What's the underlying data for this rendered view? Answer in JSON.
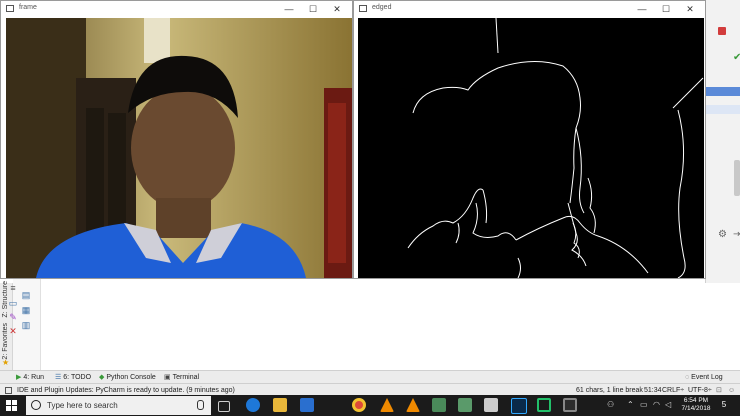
{
  "frame_window": {
    "title": "frame",
    "minimize_glyph": "—",
    "maximize_glyph": "☐",
    "close_glyph": "✕"
  },
  "edged_window": {
    "title": "edged",
    "minimize_glyph": "—",
    "maximize_glyph": "☐",
    "close_glyph": "✕"
  },
  "ide": {
    "left_tabs": {
      "structure": "Z: Structure",
      "favorites": "2: Favorites"
    },
    "tool_tabs": [
      {
        "label": "4: Run",
        "icon": "run-icon"
      },
      {
        "label": "6: TODO",
        "icon": "todo-icon"
      },
      {
        "label": "Python Console",
        "icon": "python-console-icon"
      },
      {
        "label": "Terminal",
        "icon": "terminal-icon"
      }
    ],
    "event_log": "Event Log",
    "status": {
      "message": "IDE and Plugin Updates: PyCharm is ready to update. (9 minutes ago)",
      "chars": "61 chars, 1 line break",
      "position": "51:34",
      "line_sep": "CRLF÷",
      "encoding": "UTF-8÷"
    },
    "accent": "#5b8ad8"
  },
  "taskbar": {
    "search_placeholder": "Type here to search",
    "time": "6:54 PM",
    "date": "7/14/2018",
    "notification_count": "5",
    "apps": [
      "task-view-icon",
      "edge-icon",
      "file-explorer-icon",
      "store-icon",
      "chrome-icon",
      "vlc-icon",
      "vlc-icon",
      "app-icon",
      "app-icon",
      "app-icon",
      "photos-icon",
      "photoshop-icon",
      "pycharm-icon",
      "app-icon"
    ]
  }
}
